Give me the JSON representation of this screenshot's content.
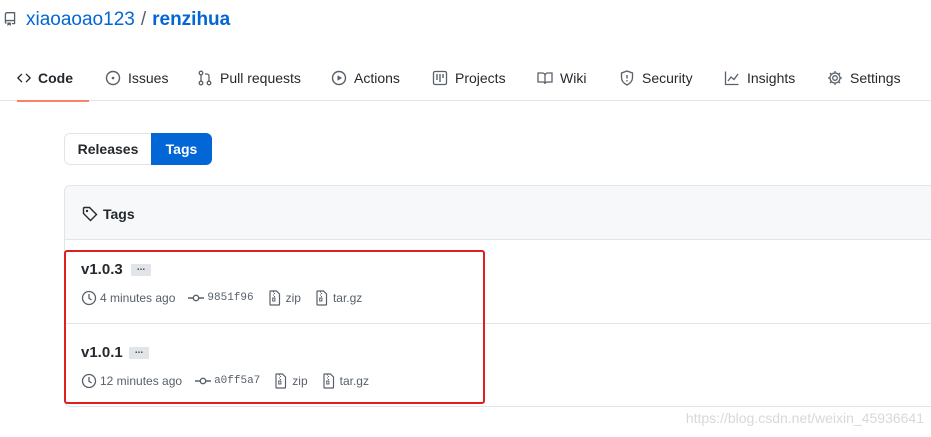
{
  "repo": {
    "owner": "xiaoaoao123",
    "separator": "/",
    "name": "renzihua"
  },
  "tabs": [
    {
      "label": "Code",
      "icon": "code-icon",
      "selected": true
    },
    {
      "label": "Issues",
      "icon": "issue-icon"
    },
    {
      "label": "Pull requests",
      "icon": "pull-request-icon"
    },
    {
      "label": "Actions",
      "icon": "play-icon"
    },
    {
      "label": "Projects",
      "icon": "project-icon"
    },
    {
      "label": "Wiki",
      "icon": "book-icon"
    },
    {
      "label": "Security",
      "icon": "shield-icon"
    },
    {
      "label": "Insights",
      "icon": "graph-icon"
    },
    {
      "label": "Settings",
      "icon": "gear-icon"
    }
  ],
  "subnav": {
    "releases_label": "Releases",
    "tags_label": "Tags",
    "selected": "Tags"
  },
  "box": {
    "header": "Tags"
  },
  "tag_list": [
    {
      "name": "v1.0.3",
      "ellipsis": "...",
      "time": "4 minutes ago",
      "commit": "9851f96",
      "zip": "zip",
      "targz": "tar.gz"
    },
    {
      "name": "v1.0.1",
      "ellipsis": "...",
      "time": "12 minutes ago",
      "commit": "a0ff5a7",
      "zip": "zip",
      "targz": "tar.gz"
    }
  ],
  "watermark": "https://blog.csdn.net/weixin_45936641",
  "colors": {
    "link": "#0366d6",
    "selected_tab_underline": "#f9826c",
    "highlight_border": "#e0201e"
  }
}
